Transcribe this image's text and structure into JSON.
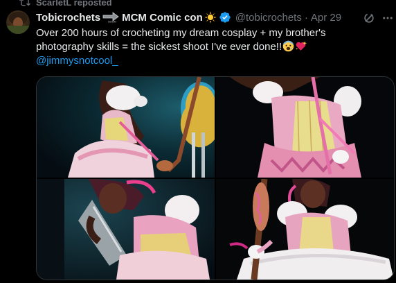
{
  "repost": {
    "icon": "repost-icon",
    "label": "ScarletL reposted"
  },
  "author": {
    "display_name": "Tobicrochets",
    "name_suffix": "MCM Comic con",
    "emoji_in_name": [
      "soon-arrow-emoji",
      "sun-emoji"
    ],
    "verified": true,
    "handle": "@tobicrochets",
    "separator": "·",
    "date": "Apr 29"
  },
  "tweet": {
    "line1": "Over 200 hours of crocheting my dream cosplay + my brother's",
    "line2": "photography skills = the sickest shoot I've ever done!!",
    "line2_emojis": [
      "fearful-face-emoji",
      "sparkling-heart-emoji"
    ],
    "mention": "@jimmysnotcool_"
  },
  "media": {
    "photos": [
      {
        "name": "photo-1",
        "description_icon": "cosplay-photo"
      },
      {
        "name": "photo-2",
        "description_icon": "cosplay-photo"
      },
      {
        "name": "photo-3",
        "description_icon": "cosplay-photo"
      },
      {
        "name": "photo-4",
        "description_icon": "cosplay-photo"
      }
    ]
  },
  "colors": {
    "background": "#000000",
    "text_primary": "#e7e9ea",
    "text_secondary": "#71767b",
    "link": "#1d9bf0",
    "verified": "#1d9bf0",
    "border": "#2f3336"
  }
}
